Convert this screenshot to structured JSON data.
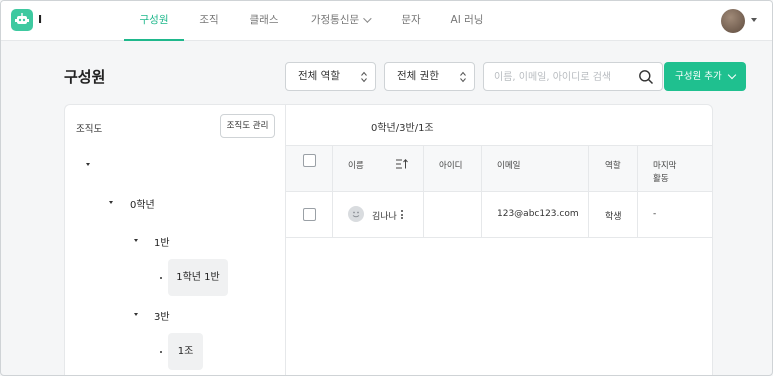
{
  "app": {
    "name": "I"
  },
  "nav": {
    "tabs": [
      {
        "label": "구성원",
        "active": true
      },
      {
        "label": "조직"
      },
      {
        "label": "클래스"
      },
      {
        "label": "가정통신문"
      },
      {
        "label": "문자"
      },
      {
        "label": "AI 러닝"
      }
    ]
  },
  "page": {
    "title": "구성원"
  },
  "filters": {
    "role": "전체 역할",
    "permission": "전체 권한",
    "search_placeholder": "이름, 이메일, 아이디로 검색"
  },
  "add_button": "구성원 추가",
  "org": {
    "label": "조직도",
    "manage_button": "조직도 관리",
    "tree": {
      "grade": "0학년",
      "class_1": "1반",
      "leaf_1": "1학년 1반",
      "class_3": "3반",
      "leaf_2": "1조"
    }
  },
  "breadcrumb": "0학년/3반/1조",
  "table": {
    "columns": {
      "name": "이름",
      "id": "아이디",
      "email": "이메일",
      "role": "역할",
      "last_activity_1": "마지막",
      "last_activity_2": "활동"
    },
    "rows": [
      {
        "name": "김나나",
        "id": "",
        "email": "123@abc123.com",
        "role": "학생",
        "last_activity": "-"
      }
    ]
  },
  "colors": {
    "accent": "#1fc08f",
    "nav_active": "#1fb88c"
  },
  "icons": {
    "logo": "robot-icon",
    "search": "search-icon",
    "sort": "sort-icon",
    "avatar": "user-avatar",
    "kebab": "more-vertical-icon"
  }
}
